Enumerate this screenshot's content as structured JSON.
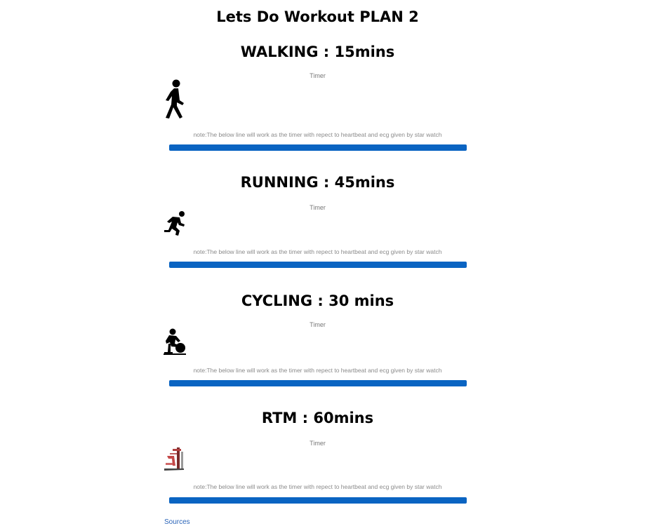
{
  "page": {
    "title": "Lets Do Workout PLAN 2"
  },
  "workouts": [
    {
      "title": "WALKING : 15mins",
      "timer_label": "Timer",
      "icon": "walking-icon",
      "note": "note:The below line will work as the timer with repect to heartbeat and ecg given by star watch"
    },
    {
      "title": "RUNNING : 45mins",
      "timer_label": "Timer",
      "icon": "running-icon",
      "note": "note:The below line will work as the timer with repect to heartbeat and ecg given by star watch"
    },
    {
      "title": "CYCLING : 30 mins",
      "timer_label": "Timer",
      "icon": "cycling-icon",
      "note": "note:The below line will work as the timer with repect to heartbeat and ecg given by star watch"
    },
    {
      "title": "RTM : 60mins",
      "timer_label": "Timer",
      "icon": "rtm-machine-icon",
      "note": "note:The below line will work as the timer with repect to heartbeat and ecg given by star watch"
    }
  ],
  "footer": {
    "sources_label": "Sources"
  },
  "colors": {
    "progress_line": "#0a64c2",
    "link": "#2a64b8"
  }
}
